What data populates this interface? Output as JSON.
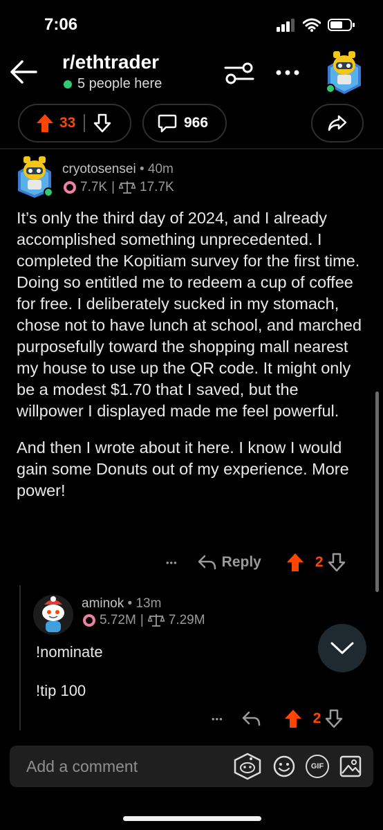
{
  "status_bar": {
    "time": "7:06"
  },
  "header": {
    "subreddit": "r/ethtrader",
    "online_text": "5 people here"
  },
  "post_actions": {
    "upvotes": "33",
    "comments": "966"
  },
  "comment": {
    "author": "cryotosensei",
    "separator": "•",
    "age": "40m",
    "donuts": "7.7K",
    "stat_sep": "|",
    "weight": "17.7K",
    "paragraphs": [
      "It’s only the third day of 2024, and I already accomplished something unprecedented. I completed the Kopitiam survey for the first time. Doing so entitled me to redeem a cup of coffee for free. I deliberately sucked in my stomach, chose not to have lunch at school, and marched purposefully toward the shopping mall nearest my house to use up the QR code. It might only be a modest $1.70 that I saved, but the willpower I displayed made me feel powerful.",
      "And then I wrote about it here. I know I would gain some Donuts out of my experience. More power!"
    ],
    "more": "•••",
    "reply_label": "Reply",
    "votes": "2"
  },
  "reply": {
    "author": "aminok",
    "separator": "•",
    "age": "13m",
    "donuts": "5.72M",
    "stat_sep": "|",
    "weight": "7.29M",
    "line1": "!nominate",
    "line2": "!tip 100",
    "more": "•••",
    "votes": "2"
  },
  "composer": {
    "placeholder": "Add a comment",
    "gif_label": "GIF"
  },
  "colors": {
    "accent": "#ff4500",
    "online": "#2ecc71",
    "background": "#000000"
  }
}
